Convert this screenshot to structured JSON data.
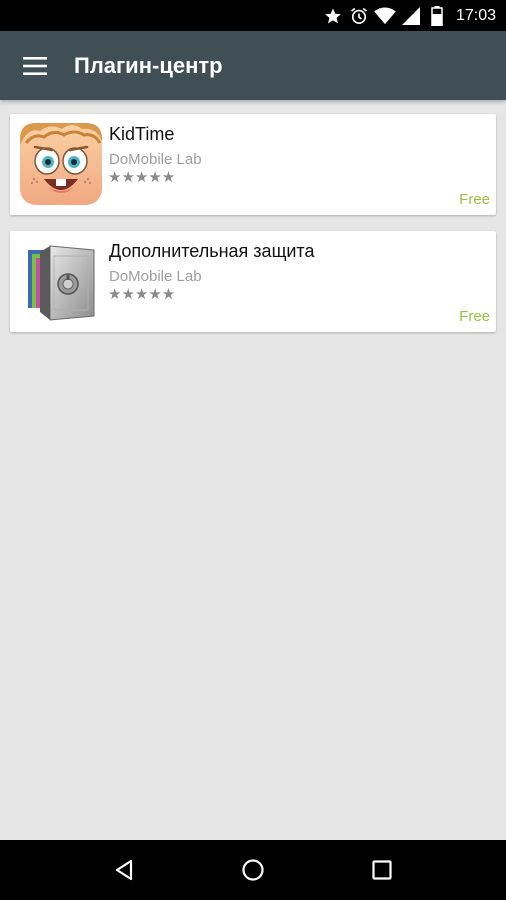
{
  "status_bar": {
    "time": "17:03",
    "icons": [
      "star-icon",
      "alarm-icon",
      "wifi-icon",
      "signal-icon",
      "battery-icon"
    ]
  },
  "app_bar": {
    "title": "Плагин-центр",
    "menu_icon": "hamburger-menu-icon"
  },
  "plugins": [
    {
      "name": "KidTime",
      "developer": "DoMobile Lab",
      "stars": "★★★★★",
      "price": "Free",
      "icon": "kidtime-face-icon"
    },
    {
      "name": "Дополнительная защита",
      "developer": "DoMobile Lab",
      "stars": "★★★★★",
      "price": "Free",
      "icon": "safe-lock-icon"
    }
  ],
  "colors": {
    "app_bar": "#3f4f55",
    "background": "#e6e6e6",
    "price": "#9bc23d"
  },
  "nav_bar": {
    "buttons": [
      "back-icon",
      "home-icon",
      "recents-icon"
    ]
  }
}
